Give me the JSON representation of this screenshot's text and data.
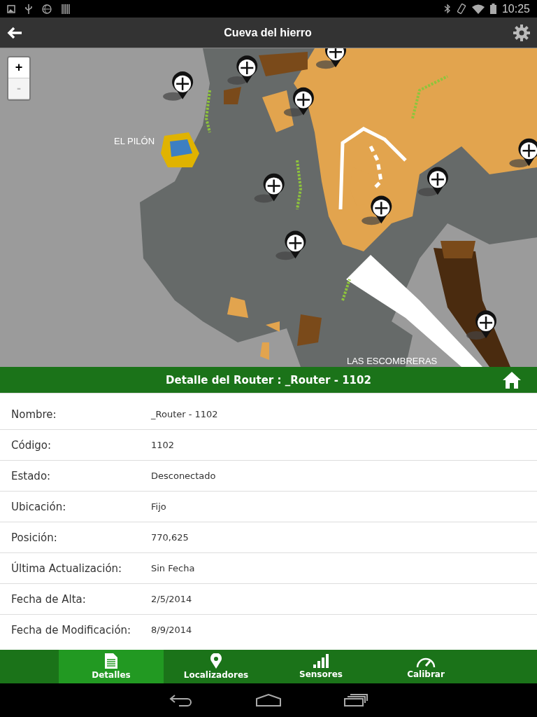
{
  "status_bar": {
    "time": "10:25"
  },
  "app_bar": {
    "title": "Cueva del hierro"
  },
  "map": {
    "zoom_in": {
      "label": "+",
      "disabled": false
    },
    "zoom_out": {
      "label": "-",
      "disabled": true
    },
    "labels": [
      {
        "text": "EL PILÓN"
      },
      {
        "text": "LAS ESCOMBRERAS"
      }
    ]
  },
  "detail": {
    "title": "Detalle del Router : _Router - 1102",
    "rows": [
      {
        "label": "Nombre:",
        "value": "_Router - 1102"
      },
      {
        "label": "Código:",
        "value": "1102"
      },
      {
        "label": "Estado:",
        "value": "Desconectado"
      },
      {
        "label": "Ubicación:",
        "value": "Fijo"
      },
      {
        "label": "Posición:",
        "value": "770,625"
      },
      {
        "label": "Última Actualización:",
        "value": "Sin Fecha"
      },
      {
        "label": "Fecha de Alta:",
        "value": "2/5/2014"
      },
      {
        "label": "Fecha de Modificación:",
        "value": "8/9/2014"
      }
    ]
  },
  "tabs": [
    {
      "label": "Detalles",
      "kind": "document",
      "selected": true
    },
    {
      "label": "Localizadores",
      "kind": "pin",
      "selected": false
    },
    {
      "label": "Sensores",
      "kind": "signal",
      "selected": false
    },
    {
      "label": "Calibrar",
      "kind": "gauge",
      "selected": false
    }
  ]
}
